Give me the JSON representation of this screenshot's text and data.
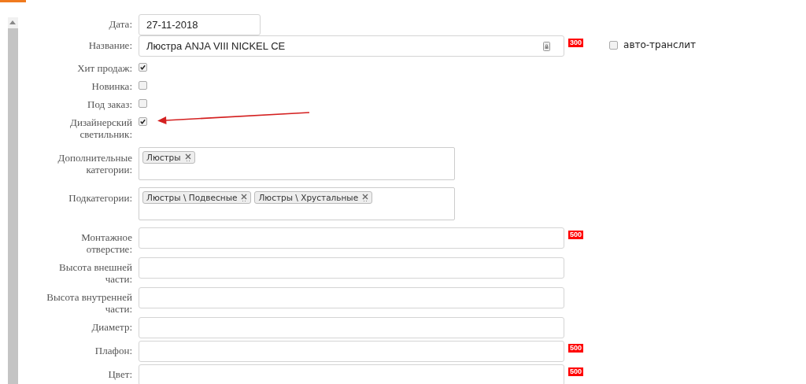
{
  "fields": [
    {
      "kind": "date",
      "label": "Дата:",
      "value": "27-11-2018"
    },
    {
      "kind": "text",
      "label": "Название:",
      "value": "Люстра ANJA VIII NICKEL CE",
      "has_icon": true,
      "limit": "300",
      "extra_checkbox": {
        "label": "авто-транслит",
        "checked": false
      }
    },
    {
      "kind": "checkbox",
      "label": "Хит продаж:",
      "checked": true
    },
    {
      "kind": "checkbox",
      "label": "Новинка:",
      "checked": false
    },
    {
      "kind": "checkbox",
      "label": "Под заказ:",
      "checked": false
    },
    {
      "kind": "checkbox",
      "label": "Дизайнерский светильник:",
      "checked": true
    },
    {
      "kind": "tags",
      "label": "Дополнительные категории:",
      "tags": [
        "Люстры"
      ]
    },
    {
      "kind": "tags",
      "label": "Подкатегории:",
      "tags": [
        "Люстры \\ Подвесные",
        "Люстры \\ Хрустальные"
      ]
    },
    {
      "kind": "text",
      "label": "Монтажное отверстие:",
      "limit": "500"
    },
    {
      "kind": "text",
      "label": "Высота внешней части:"
    },
    {
      "kind": "text",
      "label": "Высота внутренней части:"
    },
    {
      "kind": "text",
      "label": "Диаметр:"
    },
    {
      "kind": "text",
      "label": "Плафон:",
      "limit": "500"
    },
    {
      "kind": "text",
      "label": "Цвет:",
      "limit": "500"
    }
  ]
}
